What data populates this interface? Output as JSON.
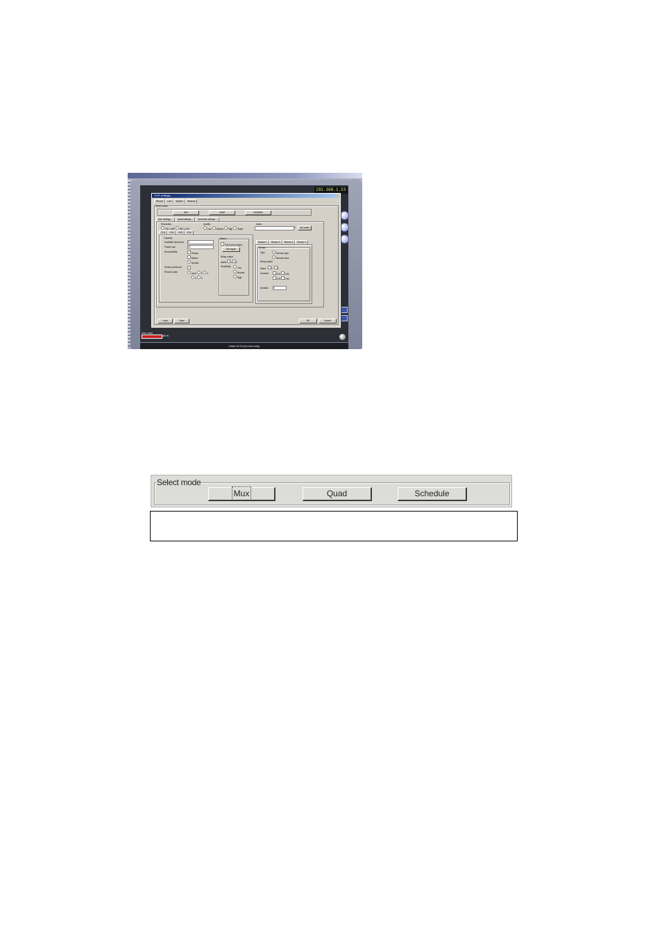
{
  "screenshot": {
    "ip_address": "192.168.1.53",
    "bottom_status": "initial 10.04 (for test only)",
    "meter_value": "46 %",
    "meter_label": "DISK USED",
    "dialog": {
      "title": "DVR settings...",
      "close": "x",
      "top_tabs": [
        "Record",
        "Live",
        "System",
        "Network"
      ],
      "select_mode_label": "Select mode",
      "mode_buttons": [
        "Mux",
        "Quad",
        "Schedule"
      ],
      "settings_tabs": [
        "Mux settings...",
        "Quad settings...",
        "Schedule settings..."
      ],
      "resolution_label": "Resolution",
      "resolution_options": [
        "720 x 480",
        "360 x 240"
      ],
      "quality_label": "Quality",
      "quality_options": [
        "Low",
        "Normal",
        "High",
        "Super"
      ],
      "audio_label": "Audio",
      "audio_value": "0",
      "audio_button": "Set audio",
      "channel_tabs": [
        "CH1",
        "CH2",
        "CH3",
        "CH4"
      ],
      "capacity_label": "Capacity",
      "available_label": "Available (seconds)",
      "available_value": "0",
      "frame_rate_label": "Frame rate",
      "frame_rate_value": "30",
      "recordability_label": "Recordability",
      "recordability_options": [
        "Sensor",
        "Motion",
        "Normal"
      ],
      "sensor_prerecord_label": "Sensor prerecord",
      "record_audio_label": "Record audio",
      "record_audio_options": [
        "none",
        "1",
        "2",
        "3",
        "4"
      ],
      "motion_label": "Motion",
      "full_screen_label": "Full screen region",
      "set_region_button": "Set region",
      "relay_output_label": "Relay output",
      "alarm_label": "Alarm",
      "alarm_options": [
        "1",
        "2"
      ],
      "sensitivity_label": "Sensitivity",
      "sensitivity_options": [
        "Low",
        "Normal",
        "High"
      ],
      "sensor_tabs": [
        "Sensor 1",
        "Sensor 2",
        "Sensor 3",
        "Sensor 4"
      ],
      "sensor_label": "Sensor",
      "type_label": "Type",
      "type_options": [
        "Normal open",
        "Normal close"
      ],
      "relay_switch_label": "Relay switch",
      "alarm2_label": "Alarm",
      "alarm2_options": [
        "1",
        "2"
      ],
      "channel_label": "Channel",
      "channel_options": [
        "CH1",
        "CH2",
        "CH3",
        "CH4"
      ],
      "duration_label": "Duration",
      "duration_value": "5",
      "load_button": "Load",
      "save_button": "Save",
      "ok_button": "OK",
      "cancel_button": "Cancel"
    }
  },
  "select_mode": {
    "legend": "Select mode",
    "buttons": [
      "Mux",
      "Quad",
      "Schedule"
    ]
  },
  "caption_text": ""
}
